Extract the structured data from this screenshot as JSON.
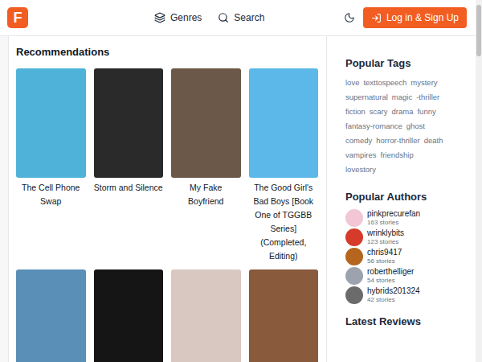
{
  "header": {
    "logo": "F",
    "nav": [
      {
        "label": "Genres",
        "icon": "layers"
      },
      {
        "label": "Search",
        "icon": "search"
      }
    ],
    "login_button": "Log in & Sign Up"
  },
  "recommendations": {
    "title": "Recommendations",
    "books": [
      {
        "title": "The Cell Phone Swap",
        "color": "#4fb3d9"
      },
      {
        "title": "Storm and Silence",
        "color": "#2a2a2a"
      },
      {
        "title": "My Fake Boyfriend",
        "color": "#6b5848"
      },
      {
        "title": "The Good Girl's Bad Boys [Book One of TGGBB Series] (Completed, Editing)",
        "color": "#5bb8e8"
      },
      {
        "color": "#5a8fb8"
      },
      {
        "color": "#151515"
      },
      {
        "color": "#d9c7c2"
      },
      {
        "color": "#8a5a3c"
      }
    ]
  },
  "popular_tags": {
    "title": "Popular Tags",
    "tags": [
      "love",
      "texttospeech",
      "mystery",
      "supernatural",
      "magic",
      "-thriller",
      "fiction",
      "scary",
      "drama",
      "funny",
      "fantasy-romance",
      "ghost",
      "comedy",
      "horror-thriller",
      "death",
      "vampires",
      "friendship",
      "lovestory"
    ]
  },
  "popular_authors": {
    "title": "Popular Authors",
    "authors": [
      {
        "name": "pinkprecurefan",
        "count": "163 stories",
        "color": "#f2c6d4"
      },
      {
        "name": "wrinklybits",
        "count": "123 stories",
        "color": "#d63a2a"
      },
      {
        "name": "chris9417",
        "count": "56 stories",
        "color": "#b5651d"
      },
      {
        "name": "roberthelliger",
        "count": "54 stories",
        "color": "#9ca3af"
      },
      {
        "name": "hybrids201324",
        "count": "42 stories",
        "color": "#6b6b6b"
      }
    ]
  },
  "latest_reviews": {
    "title": "Latest Reviews"
  }
}
